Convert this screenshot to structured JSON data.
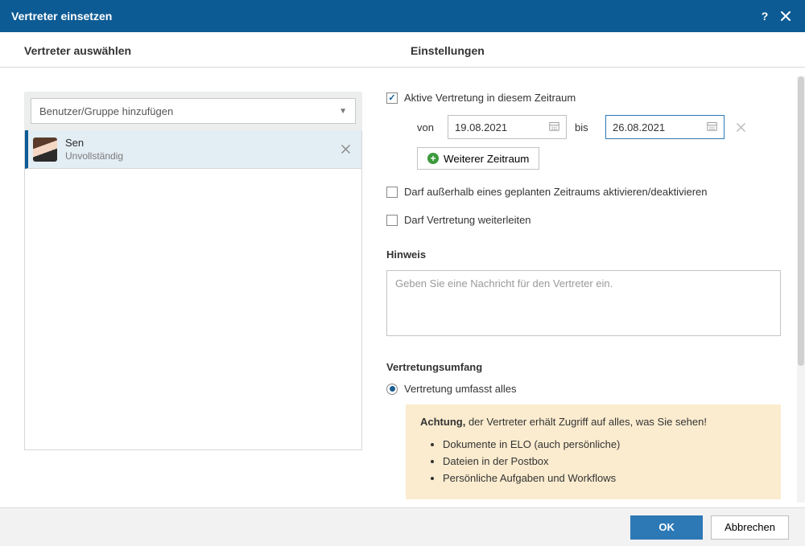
{
  "title": "Vertreter einsetzen",
  "subheader": {
    "left": "Vertreter auswählen",
    "right": "Einstellungen"
  },
  "user_picker": {
    "placeholder": "Benutzer/Gruppe hinzufügen"
  },
  "users": [
    {
      "name": "Sen",
      "status": "Unvollständig"
    }
  ],
  "settings": {
    "active_label": "Aktive Vertretung in diesem Zeitraum",
    "von_label": "von",
    "bis_label": "bis",
    "von_value": "19.08.2021",
    "bis_value": "26.08.2021",
    "add_period_label": "Weiterer Zeitraum",
    "allow_toggle_label": "Darf außerhalb eines geplanten Zeitraums aktivieren/deaktivieren",
    "allow_forward_label": "Darf Vertretung weiterleiten"
  },
  "hint": {
    "heading": "Hinweis",
    "placeholder": "Geben Sie eine Nachricht für den Vertreter ein."
  },
  "scope": {
    "heading": "Vertretungsumfang",
    "option_all": "Vertretung umfasst alles",
    "warn_prefix": "Achtung,",
    "warn_text": " der Vertreter erhält Zugriff auf alles, was Sie sehen!",
    "items": [
      "Dokumente in ELO (auch persönliche)",
      "Dateien in der Postbox",
      "Persönliche Aufgaben und Workflows"
    ]
  },
  "footer": {
    "ok": "OK",
    "cancel": "Abbrechen"
  }
}
